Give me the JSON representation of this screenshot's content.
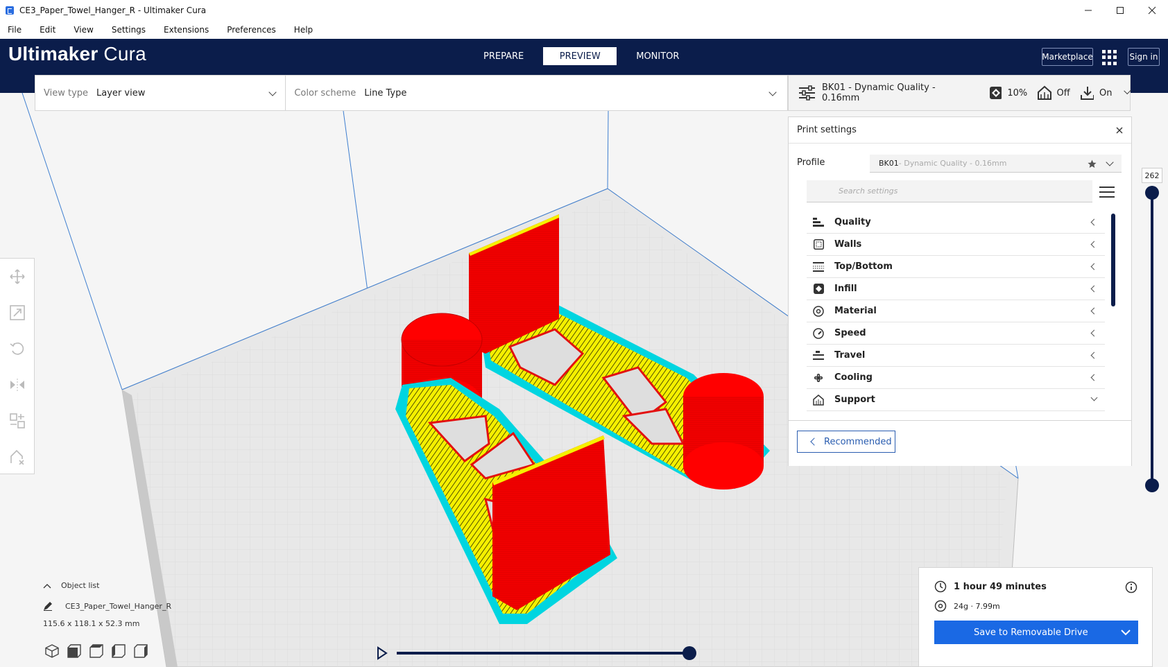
{
  "window": {
    "title": "CE3_Paper_Towel_Hanger_R - Ultimaker Cura",
    "controls": [
      "—",
      "☐",
      "✕"
    ]
  },
  "menubar": [
    "File",
    "Edit",
    "View",
    "Settings",
    "Extensions",
    "Preferences",
    "Help"
  ],
  "header": {
    "logo_bold": "Ultimaker",
    "logo_light": " Cura",
    "tabs": [
      "PREPARE",
      "PREVIEW",
      "MONITOR"
    ],
    "active_tab": "PREVIEW",
    "marketplace": "Marketplace",
    "signin": "Sign in"
  },
  "viewbar": {
    "view_type_label": "View type",
    "view_type_value": "Layer view",
    "color_scheme_label": "Color scheme",
    "color_scheme_value": "Line Type"
  },
  "printbar": {
    "profile": "BK01 - Dynamic Quality - 0.16mm",
    "infill": "10%",
    "support": "Off",
    "adhesion": "On"
  },
  "print_settings": {
    "title": "Print settings",
    "profile_label": "Profile",
    "profile_name": "BK01",
    "profile_detail": " - Dynamic Quality - 0.16mm",
    "search_placeholder": "Search settings",
    "categories": [
      {
        "label": "Quality",
        "icon": "quality-icon",
        "expanded": false
      },
      {
        "label": "Walls",
        "icon": "walls-icon",
        "expanded": false
      },
      {
        "label": "Top/Bottom",
        "icon": "top-bottom-icon",
        "expanded": false
      },
      {
        "label": "Infill",
        "icon": "infill-icon",
        "expanded": false
      },
      {
        "label": "Material",
        "icon": "material-icon",
        "expanded": false
      },
      {
        "label": "Speed",
        "icon": "speed-icon",
        "expanded": false
      },
      {
        "label": "Travel",
        "icon": "travel-icon",
        "expanded": false
      },
      {
        "label": "Cooling",
        "icon": "cooling-icon",
        "expanded": false
      },
      {
        "label": "Support",
        "icon": "support-icon",
        "expanded": true
      }
    ],
    "recommended_button": "Recommended"
  },
  "layer_slider": {
    "current_layer": "262"
  },
  "object_list": {
    "header": "Object list",
    "object_name": "CE3_Paper_Towel_Hanger_R",
    "dimensions": "115.6 x 118.1 x 52.3 mm"
  },
  "output": {
    "print_time": "1 hour 49 minutes",
    "material": "24g · 7.99m",
    "save_button": "Save to Removable Drive"
  },
  "colors": {
    "header_bg": "#0b1d4b",
    "accent_blue": "#1a69e4",
    "wall_red": "#ff0000",
    "infill_yellow": "#ffff00",
    "skirt_cyan": "#00d5e0"
  }
}
